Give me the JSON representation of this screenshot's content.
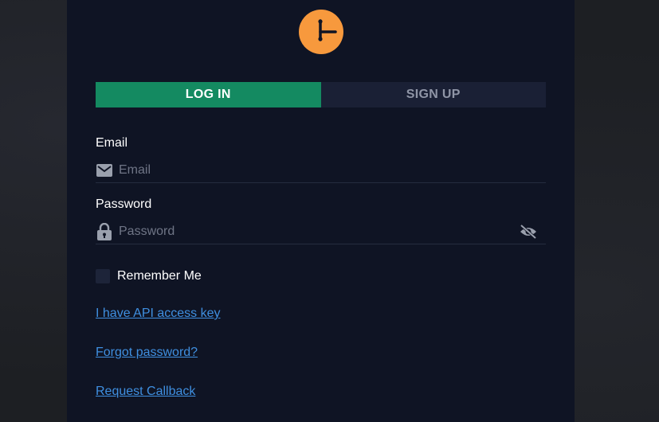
{
  "tabs": {
    "login": "LOG IN",
    "signup": "SIGN UP"
  },
  "email": {
    "label": "Email",
    "placeholder": "Email",
    "icon": "envelope-icon"
  },
  "password": {
    "label": "Password",
    "placeholder": "Password",
    "icon": "lock-icon",
    "toggle_icon": "eye-off-icon"
  },
  "remember": {
    "label": "Remember Me",
    "checked": false
  },
  "links": {
    "api_key": "I have API access key",
    "forgot": "Forgot password?",
    "callback": "Request Callback"
  },
  "colors": {
    "accent": "#148a61",
    "logo": "#f7993d",
    "panel": "#0f1424",
    "link": "#3f8fe0"
  }
}
